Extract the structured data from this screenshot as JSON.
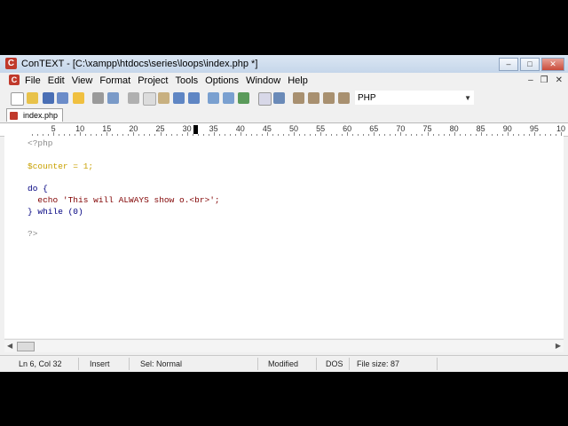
{
  "window": {
    "title": "ConTEXT - [C:\\xampp\\htdocs\\series\\loops\\index.php *]",
    "app_icon_glyph": "C",
    "controls": {
      "minimize": "–",
      "maximize": "□",
      "close": "✕"
    }
  },
  "menubar": {
    "items": [
      "File",
      "Edit",
      "View",
      "Format",
      "Project",
      "Tools",
      "Options",
      "Window",
      "Help"
    ],
    "mdi_controls": {
      "minimize": "–",
      "restore": "❐",
      "close": "✕"
    }
  },
  "toolbar": {
    "buttons": [
      "new-file",
      "open-file",
      "save",
      "save-all",
      "open-folder",
      "print",
      "print-preview",
      "cut",
      "copy",
      "paste",
      "paste-special",
      "undo",
      "redo",
      "find",
      "find-next",
      "replace",
      "file-list",
      "options",
      "user-command-1",
      "user-command-2",
      "user-command-3",
      "user-command-4"
    ],
    "language_select": "PHP"
  },
  "tabs": [
    {
      "label": "index.php *"
    }
  ],
  "ruler": {
    "labels": [
      "5",
      "10",
      "15",
      "20",
      "25",
      "30",
      "35",
      "40",
      "45",
      "50",
      "55",
      "60",
      "65",
      "70",
      "75",
      "80",
      "85",
      "90",
      "95",
      "10"
    ]
  },
  "editor": {
    "lines": [
      {
        "text": "<?php",
        "color": "#8a8a8a"
      },
      {
        "text": "",
        "color": "#000000"
      },
      {
        "text": "$counter = 1;",
        "color": "#c8a000"
      },
      {
        "text": "",
        "color": "#000000"
      },
      {
        "text": "do {",
        "color": "#000080"
      },
      {
        "text": "  echo 'This will ALWAYS show o.<br>';",
        "color": "#800000"
      },
      {
        "text": "} while (0)",
        "color": "#000080"
      },
      {
        "text": "",
        "color": "#000000"
      },
      {
        "text": "?>",
        "color": "#8a8a8a"
      }
    ]
  },
  "statusbar": {
    "position": "Ln 6, Col 32",
    "mode": "Insert",
    "selection": "Sel: Normal",
    "modified": "Modified",
    "line_endings": "DOS",
    "file_size": "File size: 87"
  }
}
